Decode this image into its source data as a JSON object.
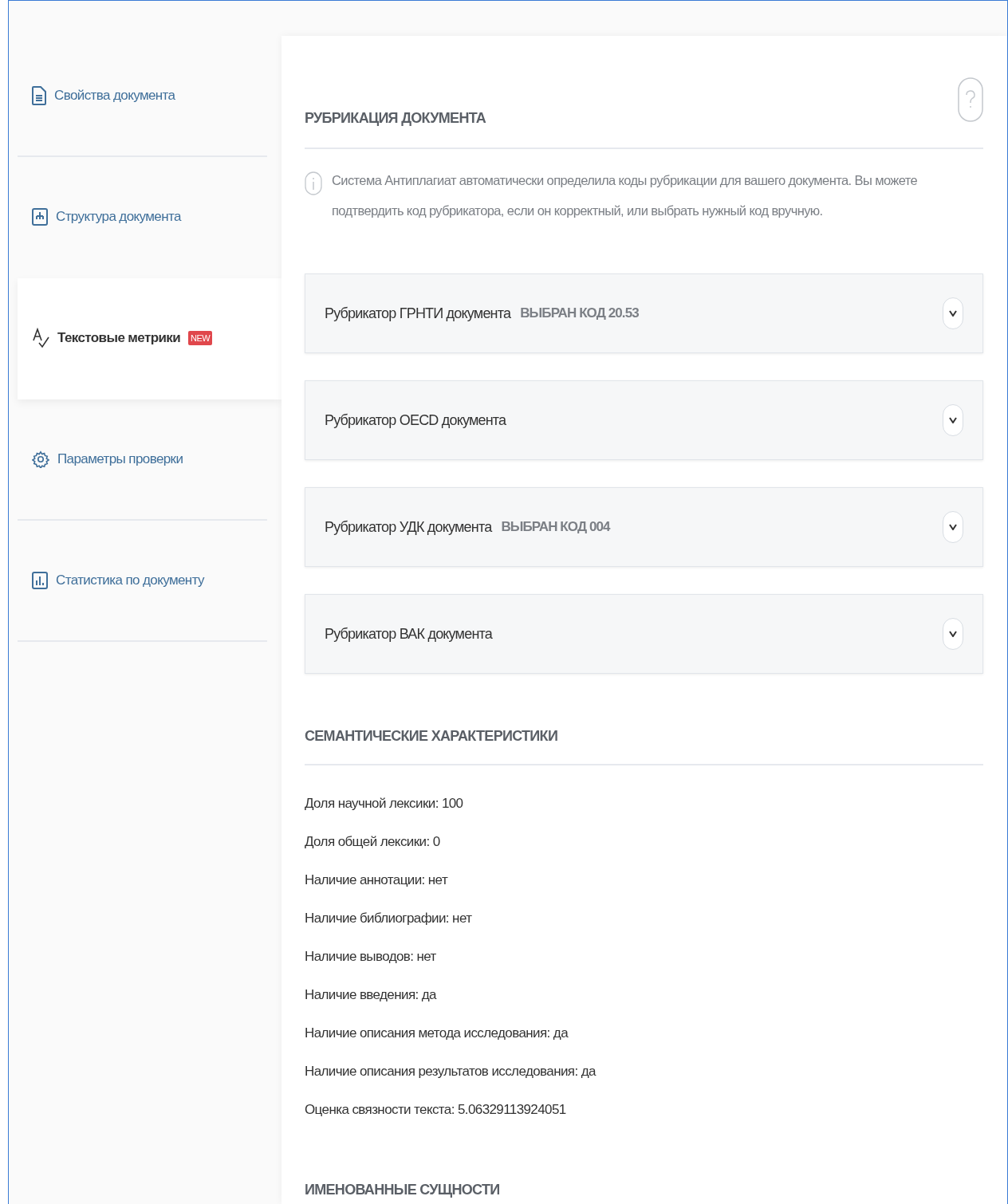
{
  "sidebar": {
    "items": [
      {
        "label": "Свойства документа",
        "kind": "document",
        "selected": false
      },
      {
        "label": "Структура документа",
        "kind": "structure",
        "selected": false
      },
      {
        "label": "Текстовые метрики",
        "kind": "metrics",
        "selected": true,
        "badge": "NEW"
      },
      {
        "label": "Параметры проверки",
        "kind": "settings",
        "selected": false
      },
      {
        "label": "Статистика по документу",
        "kind": "chart",
        "selected": false
      }
    ]
  },
  "rubrication": {
    "title": "РУБРИКАЦИЯ ДОКУМЕНТА",
    "info": "Система Антиплагиат автоматически определила коды рубрикации для вашего документа. Вы можете подтвердить код рубрикатора, если он корректный, или выбрать нужный код вручную.",
    "rubricators": [
      {
        "title": "Рубрикатор ГРНТИ документа",
        "code": "ВЫБРАН КОД 20.53",
        "expanded": false
      },
      {
        "title": "Рубрикатор OECD документа",
        "expanded": false
      },
      {
        "title": "Рубрикатор УДК документа",
        "code": "ВЫБРАН КОД 004",
        "expanded": false
      },
      {
        "title": "Рубрикатор ВАК документа",
        "expanded": false
      }
    ]
  },
  "semantic": {
    "title": "СЕМАНТИЧЕСКИЕ ХАРАКТЕРИСТИКИ",
    "rows": [
      "Доля научной лексики: 100",
      "Доля общей лексики: 0",
      "Наличие аннотации: нет",
      "Наличие библиографии: нет",
      "Наличие выводов: нет",
      "Наличие введения: да",
      "Наличие описания метода исследования: да",
      "Наличие описания результатов исследования: да",
      "Оценка связности текста: 5.06329113924051"
    ]
  },
  "entities": {
    "title": "ИМЕНОВАННЫЕ СУЩНОСТИ"
  }
}
